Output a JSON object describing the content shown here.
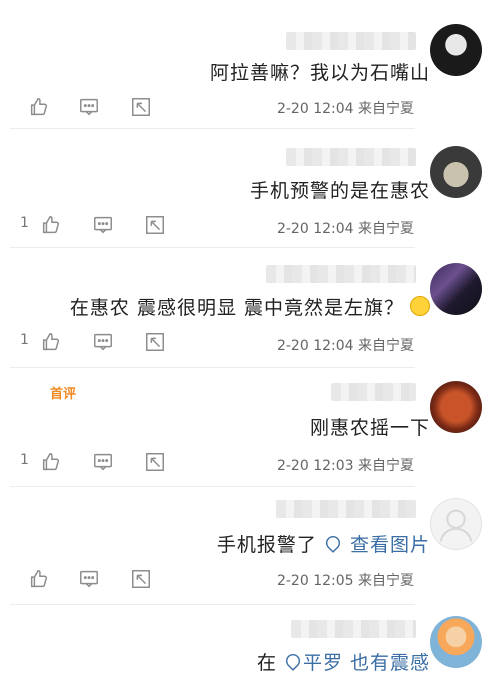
{
  "comments": [
    {
      "text": "阿拉善嘛？我以为石嘴山",
      "link": "",
      "time": "2-20 12:04",
      "location": "来自宁夏",
      "like_count": ""
    },
    {
      "text": "手机预警的是在惠农",
      "link": "",
      "time": "2-20 12:04",
      "location": "来自宁夏",
      "like_count": "1"
    },
    {
      "text": "在惠农 震感很明显 震中竟然是左旗？",
      "link": "",
      "time": "2-20 12:04",
      "location": "来自宁夏",
      "like_count": "1"
    },
    {
      "text": "刚惠农摇一下",
      "link": "",
      "time": "2-20 12:03",
      "location": "来自宁夏",
      "like_count": "1",
      "badge": "首评"
    },
    {
      "text": "手机报警了",
      "link": "查看图片",
      "time": "2-20 12:05",
      "location": "来自宁夏",
      "like_count": ""
    },
    {
      "text": "在",
      "link": "平罗 也有震感",
      "time": "",
      "location": "",
      "like_count": ""
    }
  ],
  "icons": {
    "like": "thumbs-up-icon",
    "comment": "comment-bubble-icon",
    "share": "share-icon"
  },
  "colors": {
    "link": "#3a6ea5",
    "badge": "#f08a24"
  }
}
